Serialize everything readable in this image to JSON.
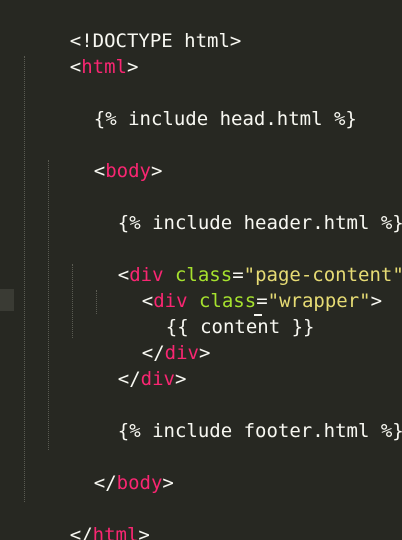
{
  "editor": {
    "theme_colors": {
      "background": "#272822",
      "text": "#F8F8F2",
      "tag": "#F92672",
      "attribute": "#A6E22E",
      "string": "#E6DB74"
    },
    "lines": {
      "doctype": "<!DOCTYPE html>",
      "html_open_lt": "<",
      "html_open_tag": "html",
      "html_open_gt": ">",
      "include_head": "{% include head.html %}",
      "body_open_lt": "<",
      "body_open_tag": "body",
      "body_open_gt": ">",
      "include_header": "{% include header.html %}",
      "div1_lt": "<",
      "div1_tag": "div",
      "div1_attr": " class",
      "div1_eq": "=",
      "div1_val": "\"page-content\"",
      "div1_gt": ">",
      "div2_lt": "<",
      "div2_tag": "div",
      "div2_attr": " class",
      "div2_eq": "=",
      "div2_val": "\"wrapper\"",
      "div2_gt": ">",
      "content_expr": "{{ content }}",
      "div2_close_lt": "</",
      "div2_close_tag": "div",
      "div2_close_gt": ">",
      "div1_close_lt": "</",
      "div1_close_tag": "div",
      "div1_close_gt": ">",
      "include_footer": "{% include footer.html %}",
      "body_close_lt": "</",
      "body_close_tag": "body",
      "body_close_gt": ">",
      "html_close_lt": "</",
      "html_close_tag": "html",
      "html_close_gt": ">"
    }
  }
}
